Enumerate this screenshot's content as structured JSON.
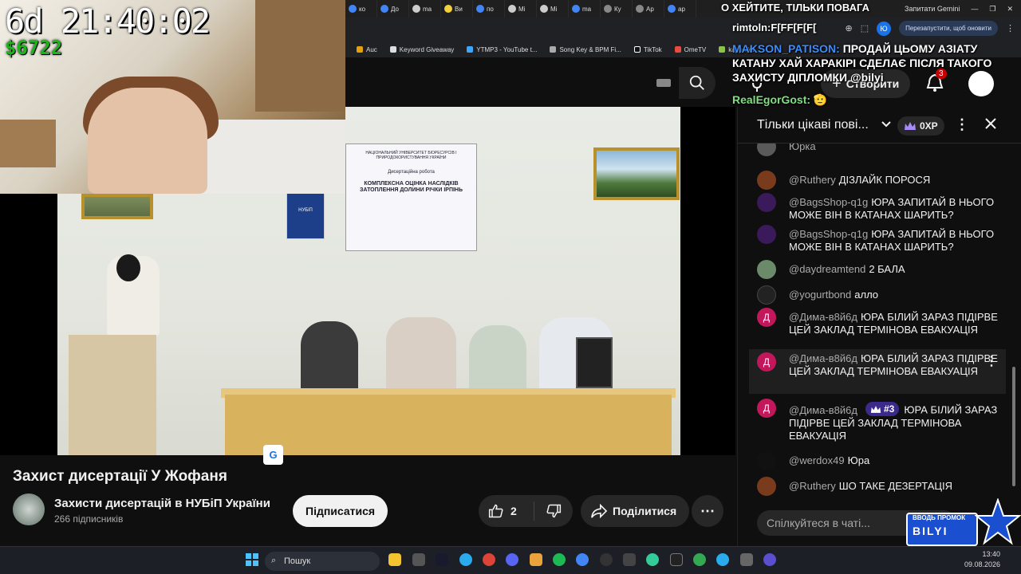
{
  "overlay": {
    "timer": "6d 21:40:02",
    "money": "$6722",
    "lines": [
      {
        "name": "",
        "text": "О ХЕЙТИТЕ, ТІЛЬКИ ПОВАГА",
        "color": "#ffffff"
      },
      {
        "name": "rimtoln:",
        "text": "F[FF[F[F[",
        "color": "#ffffff"
      },
      {
        "name": "MAKSON_PATISON:",
        "text": "ПРОДАЙ ЦЬОМУ АЗІАТУ КАТАНУ ХАЙ ХАРАКІРІ СДЕЛАЄ ПІСЛЯ ТАКОГО ЗАХИСТУ ДІПЛОМКИ @bilyi",
        "color": "#3a8dff"
      },
      {
        "name": "RealEgorGost:",
        "text": "🫡",
        "color": "#7fe07f"
      }
    ]
  },
  "browser": {
    "tabs": [
      "ко",
      "До",
      "ma",
      "Ви",
      "по",
      "Mi",
      "Mi",
      "ma",
      "Ку",
      "Ар",
      "ap"
    ],
    "gemini_label": "Запитати Gemini",
    "restart_label": "Перезапустити, щоб оновити",
    "profile_letter": "Ю",
    "bookmarks": [
      "Auc",
      "Keyword Giveaway",
      "YTMP3 - YouTube t...",
      "Song Key & BPM Fi...",
      "TikTok",
      "OmeTV",
      "kappa.lol"
    ]
  },
  "youtube": {
    "create_label": "Створити",
    "notif_count": "3"
  },
  "slide": {
    "university": "НАЦІОНАЛЬНИЙ УНІВЕРСИТЕТ БІОРЕСУРСІВ І ПРИРОДОКОРИСТУВАННЯ УКРАЇНИ",
    "kind": "Дисертаційна робота",
    "title": "КОМПЛЕКСНА ОЦІНКА НАСЛІДКІВ ЗАТОПЛЕННЯ ДОЛИНИ РІЧКИ ІРПІНЬ",
    "banner": "НУБіП"
  },
  "video": {
    "title": "Захист дисертації У Жофаня",
    "channel": "Захисти дисертацій в НУБіП України",
    "subscribers": "266 підписників",
    "subscribe_label": "Підписатися",
    "likes": "2",
    "share_label": "Поділитися",
    "more_label": "⋯",
    "translate_label": "G"
  },
  "chat": {
    "title": "Тільки цікаві пові...",
    "xp": "0XP",
    "input_placeholder": "Спілкуйтеся в чаті...",
    "messages": [
      {
        "author": "@Ruthery",
        "text": "ДІЗЛАЙК ПОРОСЯ",
        "avatar": "",
        "avatar_color": "#7a3b1c"
      },
      {
        "author": "@BagsShop-q1g",
        "text": "ЮРА ЗАПИТАЙ В НЬОГО МОЖЕ ВІН В КАТАНАХ ШАРИТЬ?",
        "avatar": "",
        "avatar_color": "#3a1a5a"
      },
      {
        "author": "@BagsShop-q1g",
        "text": "ЮРА ЗАПИТАЙ В НЬОГО МОЖЕ ВІН В КАТАНАХ ШАРИТЬ?",
        "avatar": "",
        "avatar_color": "#3a1a5a"
      },
      {
        "author": "@daydreamtend",
        "text": "2 БАЛА",
        "avatar": "",
        "avatar_color": "#6a8a6a"
      },
      {
        "author": "@yogurtbond",
        "text": "алло",
        "avatar": "",
        "avatar_color": "#222222"
      },
      {
        "author": "@Дима-в8й6д",
        "text": "ЮРА БІЛИЙ ЗАРАЗ ПІДІРВЕ ЦЕЙ ЗАКЛАД ТЕРМІНОВА ЕВАКУАЦІЯ",
        "avatar": "Д",
        "avatar_color": "#c2185b"
      },
      {
        "author": "@Дима-в8й6д",
        "text": "ЮРА БІЛИЙ ЗАРАЗ ПІДІРВЕ ЦЕЙ ЗАКЛАД ТЕРМІНОВА ЕВАКУАЦІЯ",
        "avatar": "Д",
        "avatar_color": "#c2185b"
      },
      {
        "author": "@Дима-в8й6д",
        "badge": "#3",
        "text": "ЮРА БІЛИЙ ЗАРАЗ ПІДІРВЕ ЦЕЙ ЗАКЛАД ТЕРМІНОВА ЕВАКУАЦІЯ",
        "avatar": "Д",
        "avatar_color": "#c2185b"
      },
      {
        "author": "@werdox49",
        "text": "Юра",
        "avatar": "",
        "avatar_color": "#111111"
      },
      {
        "author": "@Ruthery",
        "text": "ШО ТАКЕ ДЕЗЕРТАЦІЯ",
        "avatar": "",
        "avatar_color": "#7a3b1c"
      }
    ]
  },
  "logo": {
    "line1": "ВВОДЬ ПРОМОК",
    "line2": "BILYI"
  },
  "taskbar": {
    "search_placeholder": "Пошук",
    "time": "13:40",
    "date": "09.08.2026"
  }
}
